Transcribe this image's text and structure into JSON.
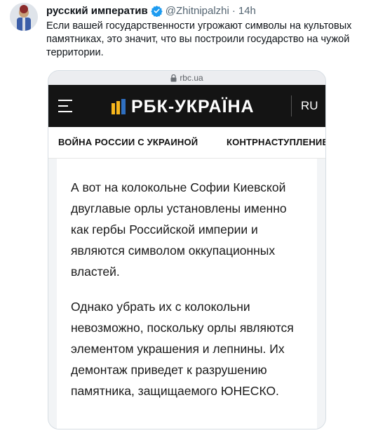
{
  "tweet": {
    "display_name": "русский императив",
    "handle": "@Zhitnipalzhi",
    "separator": "·",
    "time": "14h",
    "text": "Если вашей государственности угрожают символы на культовых памятниках, это значит, что вы построили государство на чужой территории.",
    "avatar_icon": "avatar-image",
    "verified_icon": "verified-badge-icon"
  },
  "card": {
    "url": "rbc.ua",
    "lock_icon": "lock-icon",
    "brand": "РБК-УКРАЇНА",
    "language": "RU",
    "menu_icon": "hamburger-menu-icon",
    "categories": [
      "ВОЙНА РОССИИ С УКРАИНОЙ",
      "КОНТРНАСТУПЛЕНИЕ"
    ],
    "paragraphs": [
      "А вот на колокольне Софии Киевской двуглавые орлы установлены именно как гербы Российской империи и являются символом оккупационных властей.",
      "Однако убрать их с колокольни невозможно, поскольку орлы являются элементом украшения и лепнины. Их демонтаж приведет к разрушению памятника, защищаемого ЮНЕСКО."
    ]
  },
  "colors": {
    "verified_blue": "#1d9bf0",
    "brand_yellow": "#f7b71d",
    "nav_bg": "#141414"
  }
}
